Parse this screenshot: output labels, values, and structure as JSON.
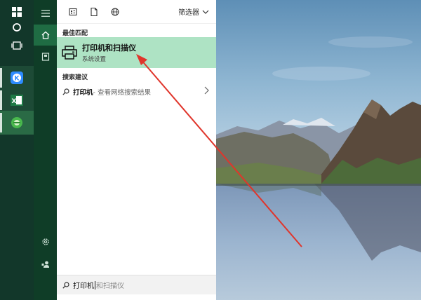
{
  "taskbar": {
    "items": [
      {
        "icon": "windows-start-icon"
      },
      {
        "icon": "cortana-circle-icon"
      },
      {
        "icon": "task-view-icon"
      },
      {
        "icon": "kugou-app-icon",
        "color": "#2d8cff"
      },
      {
        "icon": "excel-app-icon",
        "color": "#1f7a46"
      },
      {
        "icon": "green-app-icon",
        "color": "#49b84d"
      }
    ]
  },
  "rail": {
    "items": [
      {
        "icon": "hamburger-menu-icon"
      },
      {
        "icon": "home-icon"
      },
      {
        "icon": "notebook-icon"
      },
      {
        "icon": "settings-icon"
      },
      {
        "icon": "feedback-icon"
      }
    ]
  },
  "topbar": {
    "icons": [
      "apps-icon",
      "document-icon",
      "web-globe-icon"
    ],
    "filter_label": "筛选器"
  },
  "best_match": {
    "section_label": "最佳匹配",
    "title": "打印机和扫描仪",
    "subtitle": "系统设置"
  },
  "suggestions": {
    "section_label": "搜索建议",
    "items": [
      {
        "keyword": "打印机",
        "rest": " - 查看网络搜索结果"
      }
    ]
  },
  "search": {
    "typed": "打印机",
    "suggested": "和扫描仪"
  },
  "colors": {
    "highlight": "#aee3c4",
    "annotation_arrow": "#e0352b"
  }
}
